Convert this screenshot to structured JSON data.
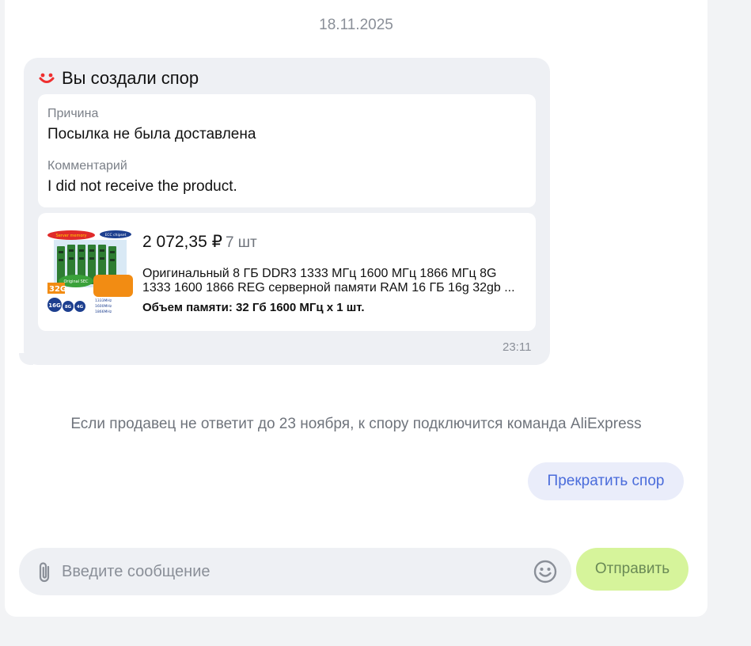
{
  "chat": {
    "date": "18.11.2025",
    "dispute_message": {
      "title": "Вы создали спор",
      "reason_label": "Причина",
      "reason_value": "Посылка не была доставлена",
      "comment_label": "Комментарий",
      "comment_value": "I did not receive the product.",
      "product": {
        "price": "2 072,35 ₽",
        "quantity": "7 шт",
        "title": "Оригинальный 8 ГБ DDR3 1333 МГц 1600 МГц 1866 МГц 8G 1333 1600 1866 REG серверной памяти RAM 16 ГБ 16g 32gb ...",
        "variant": "Объем памяти: 32 Гб 1600 МГц x 1 шт.",
        "image_labels": [
          "Server memory",
          "ECC chipset",
          "Original SEC",
          "32G",
          "16G",
          "8G",
          "4G",
          "1333MHz",
          "1600MHz",
          "1866MHz"
        ]
      },
      "time": "23:11"
    },
    "notice": "Если продавец не ответит до 23 ноября, к спору подключится команда AliExpress",
    "stop_dispute_label": "Прекратить спор",
    "composer": {
      "placeholder": "Введите сообщение",
      "value": "",
      "send_label": "Отправить"
    }
  },
  "colors": {
    "accent_red": "#ef2f2f",
    "button_blue_text": "#4a6cdb",
    "send_button_bg": "#d6f49b"
  },
  "icons": [
    "smile-logo-icon",
    "paperclip-icon",
    "emoji-icon"
  ]
}
